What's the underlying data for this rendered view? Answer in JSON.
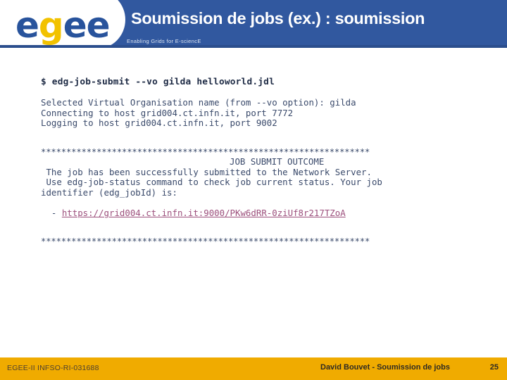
{
  "header": {
    "logo": {
      "letters": [
        "e",
        "g",
        "e",
        "e"
      ],
      "accent_color": "#f2c200",
      "base_color": "#28539c"
    },
    "title": "Soumission de jobs (ex.) : soumission",
    "tagline": "Enabling Grids for E-sciencE",
    "background_color": "#31589f"
  },
  "terminal": {
    "command": "$ edg-job-submit --vo gilda helloworld.jdl",
    "output_lines": [
      "Selected Virtual Organisation name (from --vo option): gilda",
      "Connecting to host grid004.ct.infn.it, port 7772",
      "Logging to host grid004.ct.infn.it, port 9002"
    ],
    "separator_top": "*****************************************************************",
    "outcome_heading": "JOB SUBMIT OUTCOME",
    "result_lines": [
      " The job has been successfully submitted to the Network Server.",
      " Use edg-job-status command to check job current status. Your job",
      "identifier (edg_jobId) is:"
    ],
    "job_id_prefix": "  - ",
    "job_id_url": "https://grid004.ct.infn.it:9000/PKw6dRR-0ziUf8r217TZoA",
    "separator_bottom": "*****************************************************************",
    "text_color": "#3a4a6b",
    "link_color": "#9c4f7c"
  },
  "footer": {
    "project_id": "EGEE-II INFSO-RI-031688",
    "presentation": "David Bouvet - Soumission de jobs",
    "page_number": "25",
    "background_color": "#f0ab00"
  }
}
